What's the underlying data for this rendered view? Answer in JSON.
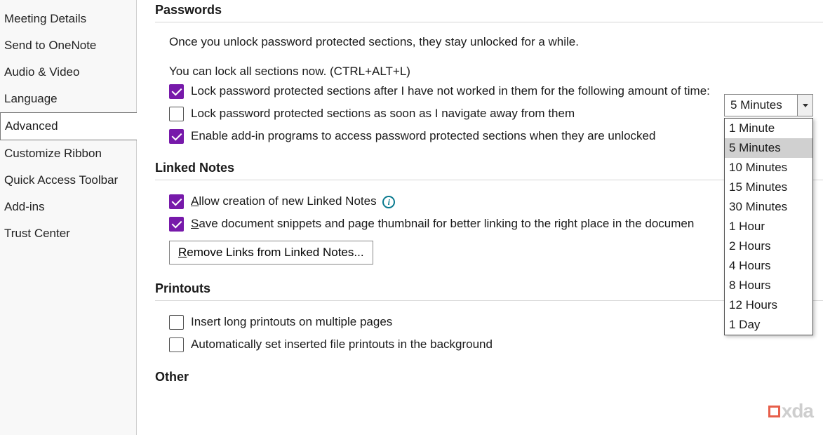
{
  "sidebar": {
    "items": [
      {
        "label": "Meeting Details"
      },
      {
        "label": "Send to OneNote"
      },
      {
        "label": "Audio & Video"
      },
      {
        "label": "Language"
      },
      {
        "label": "Advanced",
        "active": true
      },
      {
        "label": "Customize Ribbon"
      },
      {
        "label": "Quick Access Toolbar"
      },
      {
        "label": "Add-ins"
      },
      {
        "label": "Trust Center"
      }
    ]
  },
  "passwords": {
    "title": "Passwords",
    "desc": "Once you unlock password protected sections, they stay unlocked for a while.",
    "lockTip": "You can lock all sections now. (CTRL+ALT+L)",
    "lockTimeout": {
      "checked": true,
      "label": "Lock password protected sections after I have not worked in them for the following amount of time:"
    },
    "lockNavigate": {
      "checked": false,
      "label": "Lock password protected sections as soon as I navigate away from them"
    },
    "enableAddins": {
      "checked": true,
      "label": "Enable add-in programs to access password protected sections when they are unlocked"
    },
    "timeoutSelect": {
      "value": "5 Minutes",
      "options": [
        "1 Minute",
        "5 Minutes",
        "10 Minutes",
        "15 Minutes",
        "30 Minutes",
        "1 Hour",
        "2 Hours",
        "4 Hours",
        "8 Hours",
        "12 Hours",
        "1 Day"
      ]
    }
  },
  "linkedNotes": {
    "title": "Linked Notes",
    "allow": {
      "checked": true,
      "prefix": "A",
      "rest": "llow creation of new Linked Notes"
    },
    "save": {
      "checked": true,
      "prefix": "S",
      "rest": "ave document snippets and page thumbnail for better linking to the right place in the documen"
    },
    "removeBtn": {
      "prefix": "R",
      "rest": "emove Links from Linked Notes..."
    }
  },
  "printouts": {
    "title": "Printouts",
    "insertLong": {
      "checked": false,
      "label": "Insert long printouts on multiple pages"
    },
    "autoBackground": {
      "checked": false,
      "label": "Automatically set inserted file printouts in the background"
    }
  },
  "other": {
    "title": "Other"
  },
  "watermark": {
    "text": "xda"
  }
}
